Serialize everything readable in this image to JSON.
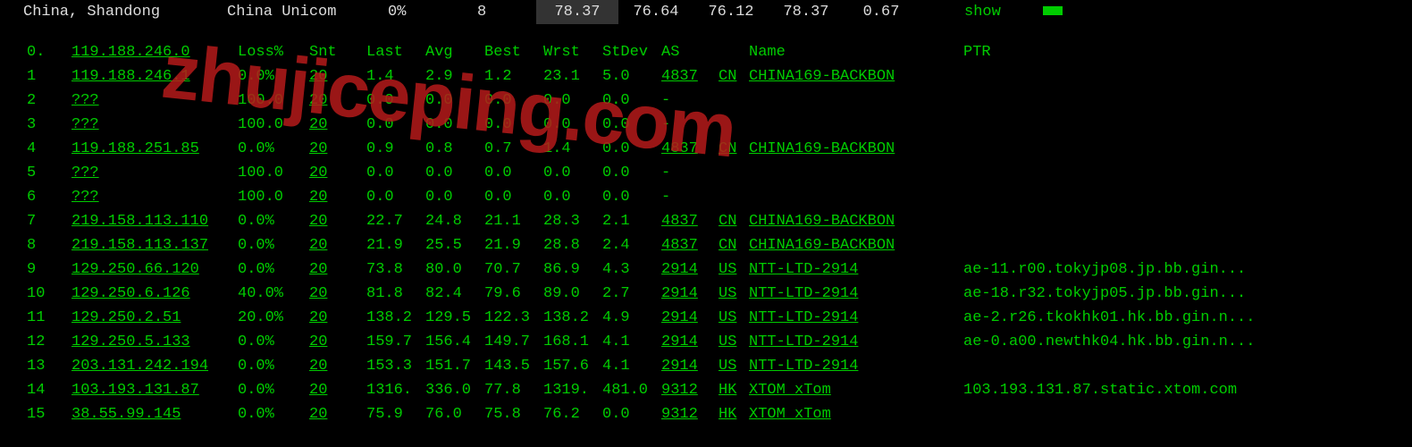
{
  "top": {
    "location": "China, Shandong",
    "isp": "China Unicom",
    "loss": "0%",
    "count": "8",
    "metrics": [
      "78.37",
      "76.64",
      "76.12",
      "78.37",
      "0.67"
    ],
    "show": "show"
  },
  "headers": {
    "hop": "0.",
    "ip": "119.188.246.0",
    "loss": "Loss%",
    "snt": "Snt",
    "last": "Last",
    "avg": "Avg",
    "best": "Best",
    "wrst": "Wrst",
    "stdev": "StDev",
    "asn": "AS",
    "asname": "Name",
    "ptr": "PTR"
  },
  "hops": [
    {
      "n": "1",
      "ip": "119.188.246.1",
      "loss": "0.0%",
      "snt": "20",
      "last": "1.4",
      "avg": "2.9",
      "best": "1.2",
      "wrst": "23.1",
      "stdev": "5.0",
      "asn": "4837",
      "cc": "CN",
      "asname": "CHINA169-BACKBON",
      "ptr": ""
    },
    {
      "n": "2",
      "ip": "???",
      "loss": "100.0",
      "snt": "20",
      "last": "0.0",
      "avg": "0.0",
      "best": "0.0",
      "wrst": "0.0",
      "stdev": "0.0",
      "asn": "-",
      "cc": "",
      "asname": "",
      "ptr": ""
    },
    {
      "n": "3",
      "ip": "???",
      "loss": "100.0",
      "snt": "20",
      "last": "0.0",
      "avg": "0.0",
      "best": "0.0",
      "wrst": "0.0",
      "stdev": "0.0",
      "asn": "-",
      "cc": "",
      "asname": "",
      "ptr": ""
    },
    {
      "n": "4",
      "ip": "119.188.251.85",
      "loss": "0.0%",
      "snt": "20",
      "last": "0.9",
      "avg": "0.8",
      "best": "0.7",
      "wrst": "1.4",
      "stdev": "0.0",
      "asn": "4837",
      "cc": "CN",
      "asname": "CHINA169-BACKBON",
      "ptr": ""
    },
    {
      "n": "5",
      "ip": "???",
      "loss": "100.0",
      "snt": "20",
      "last": "0.0",
      "avg": "0.0",
      "best": "0.0",
      "wrst": "0.0",
      "stdev": "0.0",
      "asn": "-",
      "cc": "",
      "asname": "",
      "ptr": ""
    },
    {
      "n": "6",
      "ip": "???",
      "loss": "100.0",
      "snt": "20",
      "last": "0.0",
      "avg": "0.0",
      "best": "0.0",
      "wrst": "0.0",
      "stdev": "0.0",
      "asn": "-",
      "cc": "",
      "asname": "",
      "ptr": ""
    },
    {
      "n": "7",
      "ip": "219.158.113.110",
      "loss": "0.0%",
      "snt": "20",
      "last": "22.7",
      "avg": "24.8",
      "best": "21.1",
      "wrst": "28.3",
      "stdev": "2.1",
      "asn": "4837",
      "cc": "CN",
      "asname": "CHINA169-BACKBON",
      "ptr": ""
    },
    {
      "n": "8",
      "ip": "219.158.113.137",
      "loss": "0.0%",
      "snt": "20",
      "last": "21.9",
      "avg": "25.5",
      "best": "21.9",
      "wrst": "28.8",
      "stdev": "2.4",
      "asn": "4837",
      "cc": "CN",
      "asname": "CHINA169-BACKBON",
      "ptr": ""
    },
    {
      "n": "9",
      "ip": "129.250.66.120",
      "loss": "0.0%",
      "snt": "20",
      "last": "73.8",
      "avg": "80.0",
      "best": "70.7",
      "wrst": "86.9",
      "stdev": "4.3",
      "asn": "2914",
      "cc": "US",
      "asname": "NTT-LTD-2914",
      "ptr": "ae-11.r00.tokyjp08.jp.bb.gin..."
    },
    {
      "n": "10",
      "ip": "129.250.6.126",
      "loss": "40.0%",
      "snt": "20",
      "last": "81.8",
      "avg": "82.4",
      "best": "79.6",
      "wrst": "89.0",
      "stdev": "2.7",
      "asn": "2914",
      "cc": "US",
      "asname": "NTT-LTD-2914",
      "ptr": "ae-18.r32.tokyjp05.jp.bb.gin..."
    },
    {
      "n": "11",
      "ip": "129.250.2.51",
      "loss": "20.0%",
      "snt": "20",
      "last": "138.2",
      "avg": "129.5",
      "best": "122.3",
      "wrst": "138.2",
      "stdev": "4.9",
      "asn": "2914",
      "cc": "US",
      "asname": "NTT-LTD-2914",
      "ptr": "ae-2.r26.tkokhk01.hk.bb.gin.n..."
    },
    {
      "n": "12",
      "ip": "129.250.5.133",
      "loss": "0.0%",
      "snt": "20",
      "last": "159.7",
      "avg": "156.4",
      "best": "149.7",
      "wrst": "168.1",
      "stdev": "4.1",
      "asn": "2914",
      "cc": "US",
      "asname": "NTT-LTD-2914",
      "ptr": "ae-0.a00.newthk04.hk.bb.gin.n..."
    },
    {
      "n": "13",
      "ip": "203.131.242.194",
      "loss": "0.0%",
      "snt": "20",
      "last": "153.3",
      "avg": "151.7",
      "best": "143.5",
      "wrst": "157.6",
      "stdev": "4.1",
      "asn": "2914",
      "cc": "US",
      "asname": "NTT-LTD-2914",
      "ptr": ""
    },
    {
      "n": "14",
      "ip": "103.193.131.87",
      "loss": "0.0%",
      "snt": "20",
      "last": "1316.",
      "avg": "336.0",
      "best": "77.8",
      "wrst": "1319.",
      "stdev": "481.0",
      "asn": "9312",
      "cc": "HK",
      "asname": "XTOM xTom",
      "ptr": "103.193.131.87.static.xtom.com"
    },
    {
      "n": "15",
      "ip": "38.55.99.145",
      "loss": "0.0%",
      "snt": "20",
      "last": "75.9",
      "avg": "76.0",
      "best": "75.8",
      "wrst": "76.2",
      "stdev": "0.0",
      "asn": "9312",
      "cc": "HK",
      "asname": "XTOM xTom",
      "ptr": ""
    }
  ],
  "watermark": "zhujiceping.com"
}
